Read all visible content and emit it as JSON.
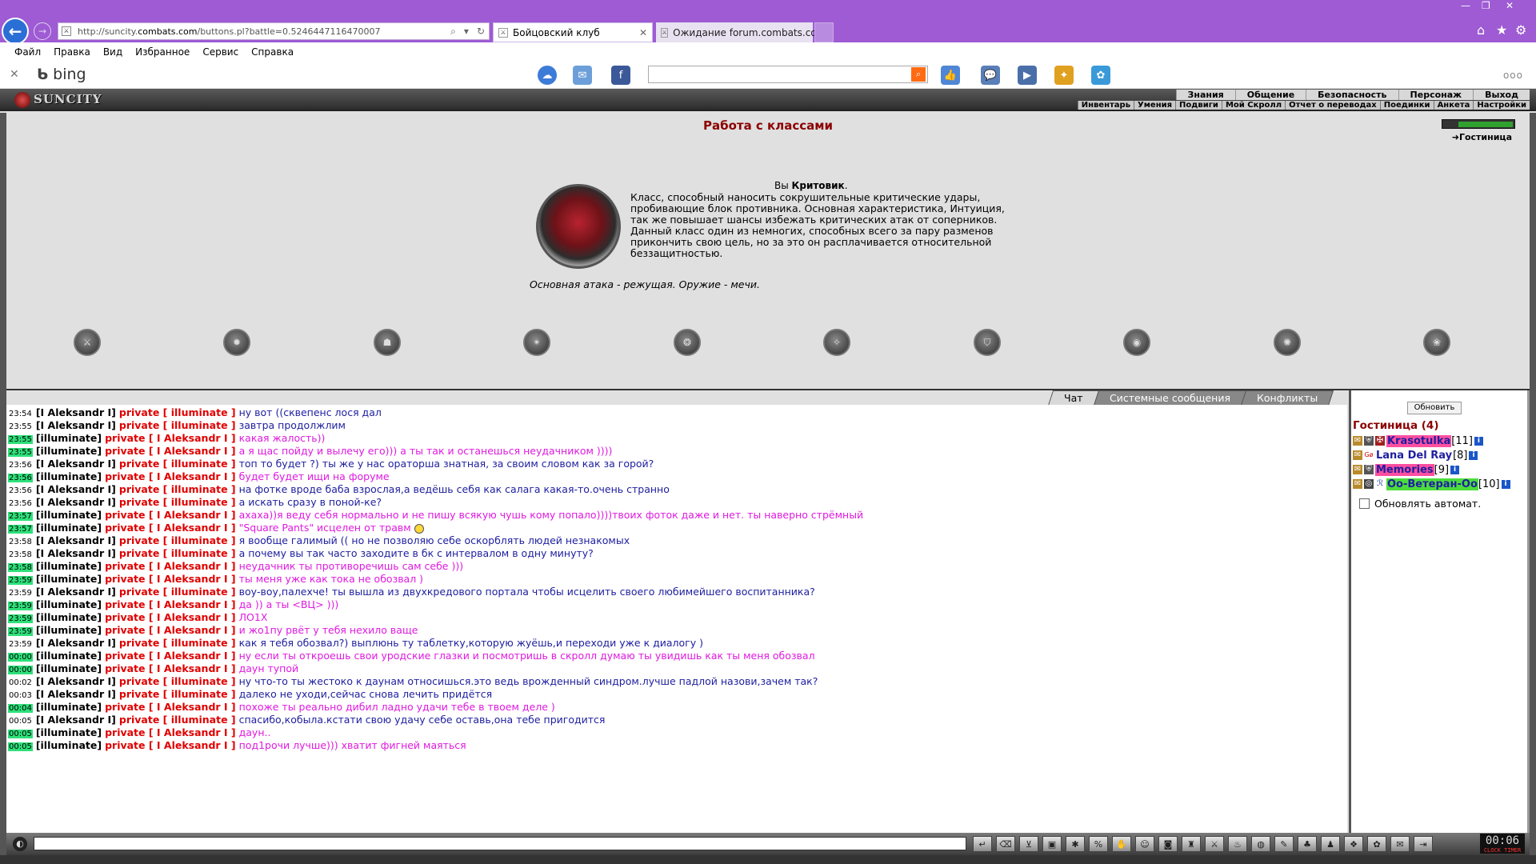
{
  "browser": {
    "url_prefix": "http://suncity.",
    "url_host": "combats.com",
    "url_path": "/buttons.pl?battle=0.5246447116470007",
    "tabs": [
      {
        "title": "Бойцовский клуб",
        "active": true
      },
      {
        "title": "Ожидание forum.combats.com",
        "active": false
      }
    ],
    "menu": [
      "Файл",
      "Правка",
      "Вид",
      "Избранное",
      "Сервис",
      "Справка"
    ],
    "bing_label": "bing",
    "search_value": ""
  },
  "game": {
    "logo": "SUNCITY",
    "top_nav": [
      "Знания",
      "Общение",
      "Безопасность",
      "Персонаж",
      "Выход"
    ],
    "sub_nav": [
      "Инвентарь",
      "Умения",
      "Подвиги",
      "Мой Скролл",
      "Отчет о переводах",
      "Поединки",
      "Анкета",
      "Настройки"
    ],
    "page_title": "Работа с классами",
    "location_link": "Гостиница",
    "class": {
      "you_prefix": "Вы",
      "name": "Критовик",
      "suffix": ".",
      "description": "Класс, способный наносить сокрушительные критические удары, пробивающие блок противника. Основная характеристика, Интуиция, так же повышает шансы избежать критических атак от соперников. Данный класс один из немногих, способных всего за пару разменов прикончить свою цель, но за это он расплачивается относительной беззащитностью.",
      "attack": "Основная атака - режущая. Оружие - мечи."
    },
    "class_icons": [
      "class-icon-1",
      "class-icon-2",
      "class-icon-3",
      "class-icon-4",
      "class-icon-5",
      "class-icon-6",
      "class-icon-7",
      "class-icon-8",
      "class-icon-9",
      "class-icon-10"
    ]
  },
  "chat": {
    "tabs": [
      "Чат",
      "Системные сообщения",
      "Конфликты"
    ],
    "lines": [
      {
        "time": "23:54",
        "hl": false,
        "from": "[I Aleksandr I]",
        "to": "private [ illuminate ]",
        "text": "ну вот ((сквепенс лося дал",
        "color": "blue"
      },
      {
        "time": "23:55",
        "hl": false,
        "from": "[I Aleksandr I]",
        "to": "private [ illuminate ]",
        "text": "завтра продолжлим",
        "color": "blue"
      },
      {
        "time": "23:55",
        "hl": true,
        "from": "[illuminate]",
        "to": "private [ I Aleksandr I ]",
        "text": "какая жалость))",
        "color": "mag"
      },
      {
        "time": "23:55",
        "hl": true,
        "from": "[illuminate]",
        "to": "private [ I Aleksandr I ]",
        "text": "а я щас пойду и вылечу его))) а ты так и останешься неудачником ))))",
        "color": "mag"
      },
      {
        "time": "23:56",
        "hl": false,
        "from": "[I Aleksandr I]",
        "to": "private [ illuminate ]",
        "text": "топ то будет ?) ты же у нас ораторша знатная, за своим словом как за горой?",
        "color": "blue"
      },
      {
        "time": "23:56",
        "hl": true,
        "from": "[illuminate]",
        "to": "private [ I Aleksandr I ]",
        "text": "будет будет ищи на форуме",
        "color": "mag"
      },
      {
        "time": "23:56",
        "hl": false,
        "from": "[I Aleksandr I]",
        "to": "private [ illuminate ]",
        "text": "на фотке вроде баба взрослая,а ведёшь себя как салага какая-то.очень странно",
        "color": "blue"
      },
      {
        "time": "23:56",
        "hl": false,
        "from": "[I Aleksandr I]",
        "to": "private [ illuminate ]",
        "text": "а искать сразу в поной-ке?",
        "color": "blue"
      },
      {
        "time": "23:57",
        "hl": true,
        "from": "[illuminate]",
        "to": "private [ I Aleksandr I ]",
        "text": "ахаха))я веду себя нормально и не пишу всякую чушь кому попало))))твоих фоток даже и нет. ты наверно стрёмный",
        "color": "mag"
      },
      {
        "time": "23:57",
        "hl": true,
        "from": "[illuminate]",
        "to": "private [ I Aleksandr I ]",
        "text": "\"Square Pants\" исцелен от травм",
        "color": "mag",
        "smile": true
      },
      {
        "time": "23:58",
        "hl": false,
        "from": "[I Aleksandr I]",
        "to": "private [ illuminate ]",
        "text": "я вообще галимый (( но не позволяю себе оскорблять людей незнакомых",
        "color": "blue"
      },
      {
        "time": "23:58",
        "hl": false,
        "from": "[I Aleksandr I]",
        "to": "private [ illuminate ]",
        "text": "а почему вы так часто заходите в бк с интервалом в одну минуту?",
        "color": "blue"
      },
      {
        "time": "23:58",
        "hl": true,
        "from": "[illuminate]",
        "to": "private [ I Aleksandr I ]",
        "text": "неудачник ты противоречишь сам себе )))",
        "color": "mag"
      },
      {
        "time": "23:59",
        "hl": true,
        "from": "[illuminate]",
        "to": "private [ I Aleksandr I ]",
        "text": "ты меня уже как тока не обозвал )",
        "color": "mag"
      },
      {
        "time": "23:59",
        "hl": false,
        "from": "[I Aleksandr I]",
        "to": "private [ illuminate ]",
        "text": "воу-воу,палехче! ты вышла из двухкредового портала чтобы исцелить своего любимейшего воспитанника?",
        "color": "blue"
      },
      {
        "time": "23:59",
        "hl": true,
        "from": "[illuminate]",
        "to": "private [ I Aleksandr I ]",
        "text": "да )) а ты <ВЦ> )))",
        "color": "mag"
      },
      {
        "time": "23:59",
        "hl": true,
        "from": "[illuminate]",
        "to": "private [ I Aleksandr I ]",
        "text": "ЛО1Х",
        "color": "mag"
      },
      {
        "time": "23:59",
        "hl": true,
        "from": "[illuminate]",
        "to": "private [ I Aleksandr I ]",
        "text": "и жо1пу рвёт у тебя нехило ваще",
        "color": "mag"
      },
      {
        "time": "23:59",
        "hl": false,
        "from": "[I Aleksandr I]",
        "to": "private [ illuminate ]",
        "text": "как я тебя обозвал?) выплюнь ту таблетку,которую жуёшь,и переходи уже к диалогу )",
        "color": "blue"
      },
      {
        "time": "00:00",
        "hl": true,
        "from": "[illuminate]",
        "to": "private [ I Aleksandr I ]",
        "text": "ну если ты откроешь свои уродские глазки и посмотришь в скролл думаю ты увидишь как ты меня обозвал",
        "color": "mag"
      },
      {
        "time": "00:00",
        "hl": true,
        "from": "[illuminate]",
        "to": "private [ I Aleksandr I ]",
        "text": "даун тупой",
        "color": "mag"
      },
      {
        "time": "00:02",
        "hl": false,
        "from": "[I Aleksandr I]",
        "to": "private [ illuminate ]",
        "text": "ну что-то ты жестоко к даунам относишься.это ведь врожденный синдром.лучше падлой назови,зачем так?",
        "color": "blue"
      },
      {
        "time": "00:03",
        "hl": false,
        "from": "[I Aleksandr I]",
        "to": "private [ illuminate ]",
        "text": "далеко не уходи,сейчас снова лечить придётся",
        "color": "blue"
      },
      {
        "time": "00:04",
        "hl": true,
        "from": "[illuminate]",
        "to": "private [ I Aleksandr I ]",
        "text": "похоже ты реально дибил ладно удачи тебе в твоем деле )",
        "color": "mag"
      },
      {
        "time": "00:05",
        "hl": false,
        "from": "[I Aleksandr I]",
        "to": "private [ illuminate ]",
        "text": "спасибо,кобыла.кстати свою удачу себе оставь,она тебе пригодится",
        "color": "blue"
      },
      {
        "time": "00:05",
        "hl": true,
        "from": "[illuminate]",
        "to": "private [ I Aleksandr I ]",
        "text": "даун..",
        "color": "mag"
      },
      {
        "time": "00:05",
        "hl": true,
        "from": "[illuminate]",
        "to": "private [ I Aleksandr I ]",
        "text": "под1рочи лучше))) хватит фигней маяться",
        "color": "mag"
      }
    ]
  },
  "room": {
    "refresh_label": "Обновить",
    "title": "Гостиница (4)",
    "users": [
      {
        "name": "Krasotulka",
        "level": "[11]",
        "bg": "#ff4fa0"
      },
      {
        "name": "Lana Del Ray",
        "level": "[8]",
        "bg": ""
      },
      {
        "name": "Memories",
        "level": "[9]",
        "bg": "#ff4fa0"
      },
      {
        "name": "Оо-Ветеран-Оо",
        "level": "[10]",
        "bg": "#4cdc3c"
      }
    ],
    "auto_refresh_label": "Обновлять автомат."
  },
  "bottom": {
    "clock": "00:06",
    "clock_sub": "CLOCK TIMER"
  }
}
